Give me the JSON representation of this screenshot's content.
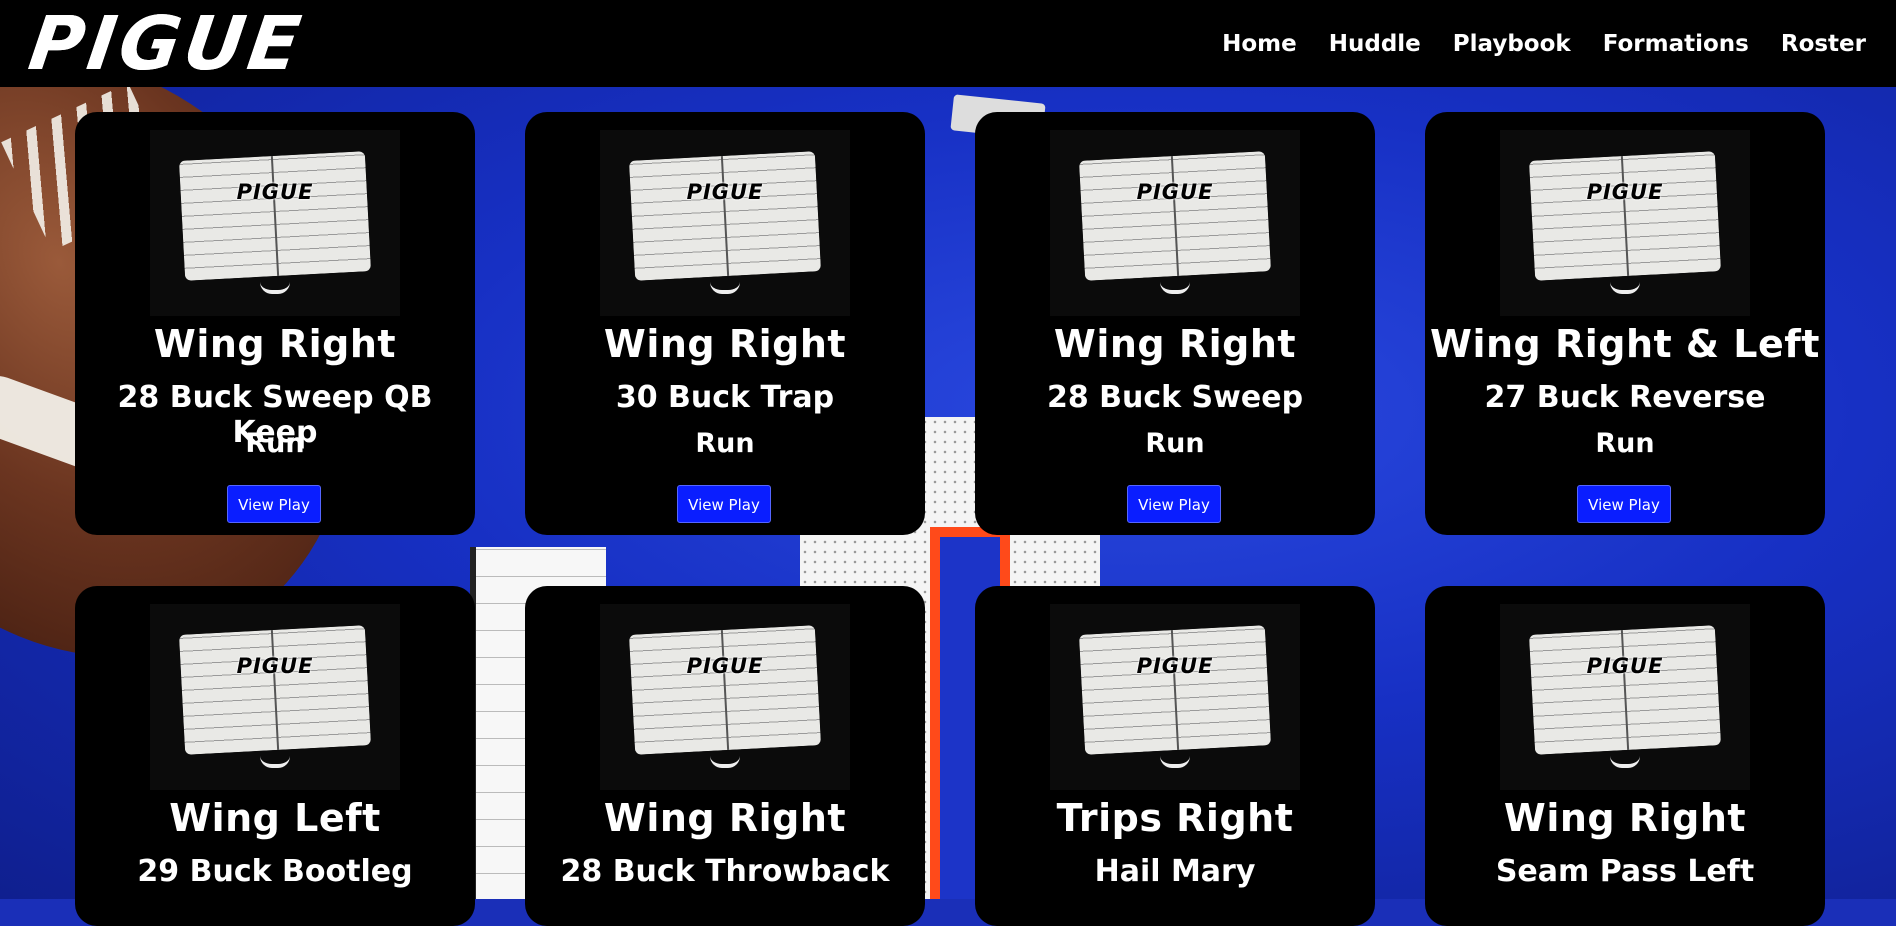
{
  "header": {
    "logo_text": "PIGUE",
    "nav": [
      "Home",
      "Huddle",
      "Playbook",
      "Formations",
      "Roster"
    ]
  },
  "colors": {
    "header_bg": "#000000",
    "card_bg": "#000000",
    "button_bg": "#0a1eff",
    "text": "#ffffff"
  },
  "cards": [
    {
      "thumb_text": "PIGUE",
      "formation": "Wing Right",
      "play": "28 Buck Sweep QB Keep",
      "type": "Run",
      "button": "View Play"
    },
    {
      "thumb_text": "PIGUE",
      "formation": "Wing Right",
      "play": "30 Buck Trap",
      "type": "Run",
      "button": "View Play"
    },
    {
      "thumb_text": "PIGUE",
      "formation": "Wing Right",
      "play": "28 Buck Sweep",
      "type": "Run",
      "button": "View Play"
    },
    {
      "thumb_text": "PIGUE",
      "formation": "Wing Right & Left",
      "play": "27 Buck Reverse",
      "type": "Run",
      "button": "View Play"
    },
    {
      "thumb_text": "PIGUE",
      "formation": "Wing Left",
      "play": "29 Buck Bootleg",
      "type": "",
      "button": ""
    },
    {
      "thumb_text": "PIGUE",
      "formation": "Wing Right",
      "play": "28 Buck Throwback",
      "type": "",
      "button": ""
    },
    {
      "thumb_text": "PIGUE",
      "formation": "Trips Right",
      "play": "Hail Mary",
      "type": "",
      "button": ""
    },
    {
      "thumb_text": "PIGUE",
      "formation": "Wing Right",
      "play": "Seam Pass Left",
      "type": "",
      "button": ""
    }
  ]
}
